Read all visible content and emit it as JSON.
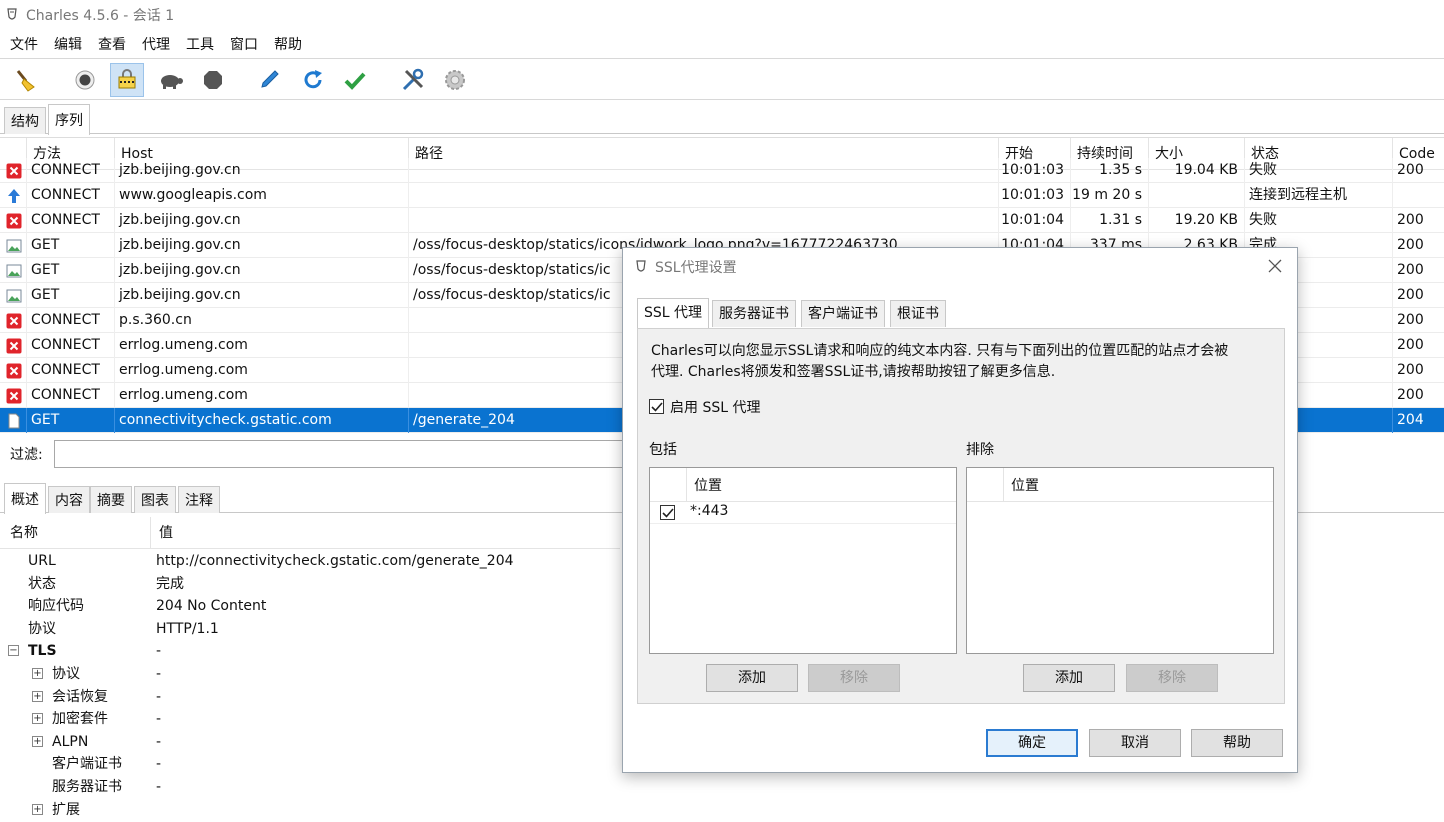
{
  "window": {
    "title": "Charles 4.5.6 - 会话 1"
  },
  "menubar": [
    "文件",
    "编辑",
    "查看",
    "代理",
    "工具",
    "窗口",
    "帮助"
  ],
  "toolbar": {
    "icons": [
      "broom-icon",
      "record-icon",
      "throttle-icon",
      "turtle-icon",
      "stop-icon",
      "pen-icon",
      "refresh-icon",
      "check-icon",
      "tools-icon",
      "settings-icon"
    ]
  },
  "view_tabs": [
    "结构",
    "序列"
  ],
  "table": {
    "headers": [
      "方法",
      "Host",
      "路径",
      "开始",
      "持续时间",
      "大小",
      "状态",
      "Code"
    ],
    "rows": [
      {
        "icon": "error",
        "method": "CONNECT",
        "host": "jzb.beijing.gov.cn",
        "path": "",
        "start": "10:01:03",
        "duration": "1.35 s",
        "size": "19.04 KB",
        "status": "失败",
        "code": "200"
      },
      {
        "icon": "upload",
        "method": "CONNECT",
        "host": "www.googleapis.com",
        "path": "",
        "start": "10:01:03",
        "duration": "19 m 20 s",
        "size": "",
        "status": "连接到远程主机",
        "code": ""
      },
      {
        "icon": "error",
        "method": "CONNECT",
        "host": "jzb.beijing.gov.cn",
        "path": "",
        "start": "10:01:04",
        "duration": "1.31 s",
        "size": "19.20 KB",
        "status": "失败",
        "code": "200"
      },
      {
        "icon": "image",
        "method": "GET",
        "host": "jzb.beijing.gov.cn",
        "path": "/oss/focus-desktop/statics/icons/idwork_logo.png?v=1677722463730",
        "start": "10:01:04",
        "duration": "337 ms",
        "size": "2.63 KB",
        "status": "完成",
        "code": "200"
      },
      {
        "icon": "image",
        "method": "GET",
        "host": "jzb.beijing.gov.cn",
        "path": "/oss/focus-desktop/statics/ic",
        "start": "",
        "duration": "",
        "size": "",
        "status": "",
        "code": "200"
      },
      {
        "icon": "image",
        "method": "GET",
        "host": "jzb.beijing.gov.cn",
        "path": "/oss/focus-desktop/statics/ic",
        "start": "",
        "duration": "",
        "size": "",
        "status": "",
        "code": "200"
      },
      {
        "icon": "error",
        "method": "CONNECT",
        "host": "p.s.360.cn",
        "path": "",
        "start": "",
        "duration": "",
        "size": "",
        "status": "",
        "code": "200"
      },
      {
        "icon": "error",
        "method": "CONNECT",
        "host": "errlog.umeng.com",
        "path": "",
        "start": "",
        "duration": "",
        "size": "",
        "status": "",
        "code": "200"
      },
      {
        "icon": "error",
        "method": "CONNECT",
        "host": "errlog.umeng.com",
        "path": "",
        "start": "",
        "duration": "",
        "size": "",
        "status": "",
        "code": "200"
      },
      {
        "icon": "error",
        "method": "CONNECT",
        "host": "errlog.umeng.com",
        "path": "",
        "start": "",
        "duration": "",
        "size": "",
        "status": "",
        "code": "200"
      },
      {
        "icon": "doc",
        "method": "GET",
        "host": "connectivitycheck.gstatic.com",
        "path": "/generate_204",
        "start": "",
        "duration": "",
        "size": "",
        "status": "",
        "code": "204",
        "selected": true
      }
    ]
  },
  "filter": {
    "label": "过滤:",
    "value": ""
  },
  "detail_tabs": [
    "概述",
    "内容",
    "摘要",
    "图表",
    "注释"
  ],
  "overview": {
    "headers": [
      "名称",
      "值"
    ],
    "rows": [
      {
        "name": "URL",
        "value": "http://connectivitycheck.gstatic.com/generate_204",
        "indent": 0
      },
      {
        "name": "状态",
        "value": "完成",
        "indent": 0
      },
      {
        "name": "响应代码",
        "value": "204 No Content",
        "indent": 0
      },
      {
        "name": "协议",
        "value": "HTTP/1.1",
        "indent": 0
      },
      {
        "name": "TLS",
        "value": "-",
        "indent": 0,
        "expander": "minus",
        "bold": true
      },
      {
        "name": "协议",
        "value": "-",
        "indent": 1,
        "expander": "plus"
      },
      {
        "name": "会话恢复",
        "value": "-",
        "indent": 1,
        "expander": "plus"
      },
      {
        "name": "加密套件",
        "value": "-",
        "indent": 1,
        "expander": "plus"
      },
      {
        "name": "ALPN",
        "value": "-",
        "indent": 1,
        "expander": "plus"
      },
      {
        "name": "客户端证书",
        "value": "-",
        "indent": 1
      },
      {
        "name": "服务器证书",
        "value": "-",
        "indent": 1
      },
      {
        "name": "扩展",
        "value": "",
        "indent": 1,
        "expander": "plus"
      }
    ]
  },
  "dialog": {
    "title": "SSL代理设置",
    "tabs": [
      "SSL 代理",
      "服务器证书",
      "客户端证书",
      "根证书"
    ],
    "description_line1": "Charles可以向您显示SSL请求和响应的纯文本内容. 只有与下面列出的位置匹配的站点才会被",
    "description_line2": "代理. Charles将颁发和签署SSL证书,请按帮助按钮了解更多信息.",
    "enable_label": "启用 SSL 代理",
    "enable_checked": true,
    "include_label": "包括",
    "exclude_label": "排除",
    "location_header": "位置",
    "include_items": [
      {
        "checked": true,
        "location": "*:443"
      }
    ],
    "add_label": "添加",
    "remove_label": "移除",
    "ok_label": "确定",
    "cancel_label": "取消",
    "help_label": "帮助"
  },
  "colors": {
    "selection": "#0a73d0",
    "error": "#e0242b",
    "upload": "#2b7bd8",
    "accent": "#2b7bd1"
  }
}
